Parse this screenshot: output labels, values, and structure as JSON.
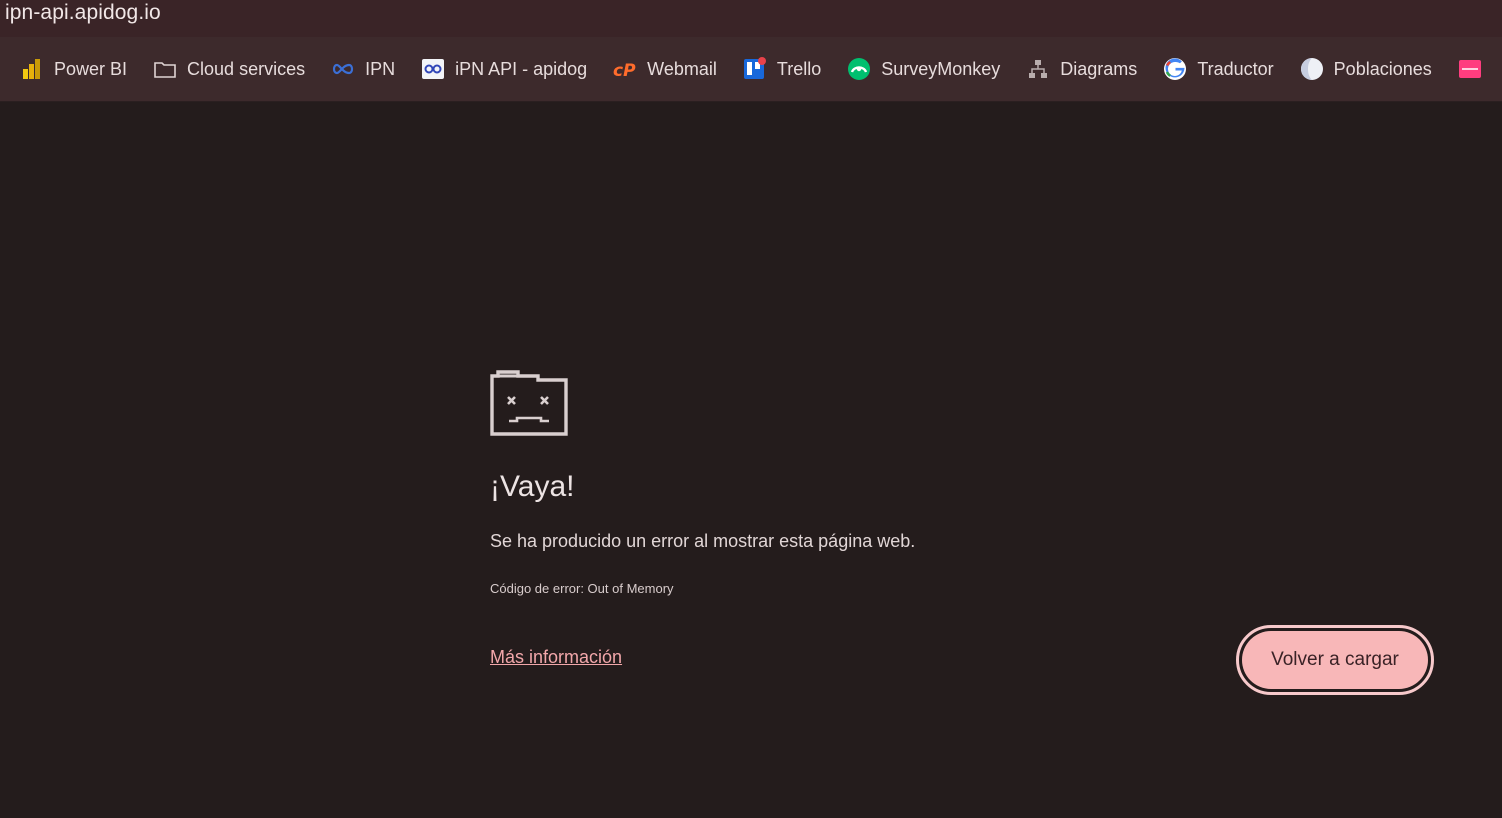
{
  "address_bar": {
    "url": "ipn-api.apidog.io"
  },
  "bookmarks": [
    {
      "label": "Power BI",
      "icon": "powerbi-icon"
    },
    {
      "label": "Cloud services",
      "icon": "folder-icon"
    },
    {
      "label": "IPN",
      "icon": "infinity-icon"
    },
    {
      "label": "iPN API - apidog",
      "icon": "apidog-icon"
    },
    {
      "label": "Webmail",
      "icon": "cpanel-icon"
    },
    {
      "label": "Trello",
      "icon": "trello-icon"
    },
    {
      "label": "SurveyMonkey",
      "icon": "surveymonkey-icon"
    },
    {
      "label": "Diagrams",
      "icon": "diagram-icon"
    },
    {
      "label": "Traductor",
      "icon": "google-icon"
    },
    {
      "label": "Poblaciones",
      "icon": "globe-icon"
    }
  ],
  "error_page": {
    "title": "¡Vaya!",
    "message": "Se ha producido un error al mostrar esta página web.",
    "error_code": "Código de error: Out of Memory",
    "more_info_link": "Más información",
    "reload_button": "Volver a cargar"
  },
  "colors": {
    "background": "#241c1c",
    "bookmark_bar": "#3d2a2c",
    "accent_link": "#f2a7aa",
    "button_fill": "#f8b7b8"
  }
}
